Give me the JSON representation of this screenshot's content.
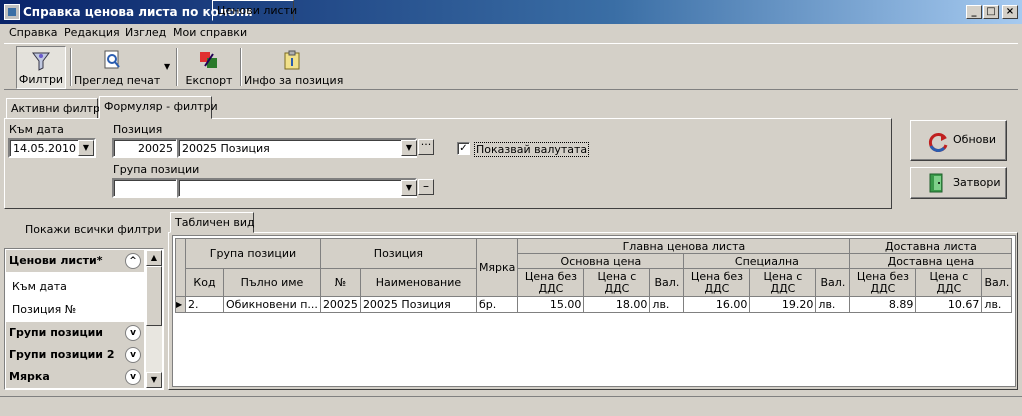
{
  "window": {
    "title": "Справка ценова листа по колони"
  },
  "menu": [
    "Справка",
    "Редакция",
    "Изглед",
    "Мои справки"
  ],
  "toolbar": {
    "filters": "Филтри",
    "print_preview": "Преглед печат",
    "export": "Експорт",
    "position_info": "Инфо за позиция"
  },
  "tabs": [
    "Активни филтри",
    "Формуляр - филтри",
    "Ценови листи"
  ],
  "form": {
    "to_date_label": "Към дата",
    "to_date_value": "14.05.2010",
    "position_label": "Позиция",
    "position_code": "20025",
    "position_name": "20025 Позиция",
    "group_label": "Група позиции",
    "group_code": "",
    "group_name": "",
    "show_currency_label": "Показвай валутата",
    "show_currency_checked": true
  },
  "buttons": {
    "refresh": "Обнови",
    "close": "Затвори"
  },
  "left_panel": {
    "show_all": "Покажи всички филтри",
    "sections": [
      {
        "title": "Ценови листи*",
        "expanded": true,
        "items": [
          "Към дата",
          "Позиция №"
        ]
      },
      {
        "title": "Групи позиции",
        "expanded": false
      },
      {
        "title": "Групи позиции 2",
        "expanded": false
      },
      {
        "title": "Мярка",
        "expanded": false
      }
    ]
  },
  "grid": {
    "tab": "Табличен вид",
    "groups": {
      "item_group": "Група позиции",
      "position": "Позиция",
      "unit": "Мярка",
      "main_list": "Главна ценова листа",
      "delivery_list": "Доставна листа",
      "base_price": "Основна цена",
      "special": "Специална",
      "delivery_price": "Доставна цена"
    },
    "cols": {
      "code": "Код",
      "full_name": "Пълно име",
      "no": "№",
      "name": "Наименование",
      "price_no_vat": "Цена без ДДС",
      "price_vat": "Цена с ДДС",
      "currency": "Вал."
    },
    "rows": [
      {
        "code": "2.",
        "full_name": "Обикновени п...",
        "no": "20025",
        "name": "20025 Позиция",
        "unit": "бр.",
        "b1": "15.00",
        "b2": "18.00",
        "b3": "лв.",
        "s1": "16.00",
        "s2": "19.20",
        "s3": "лв.",
        "d1": "8.89",
        "d2": "10.67",
        "d3": "лв."
      }
    ]
  }
}
